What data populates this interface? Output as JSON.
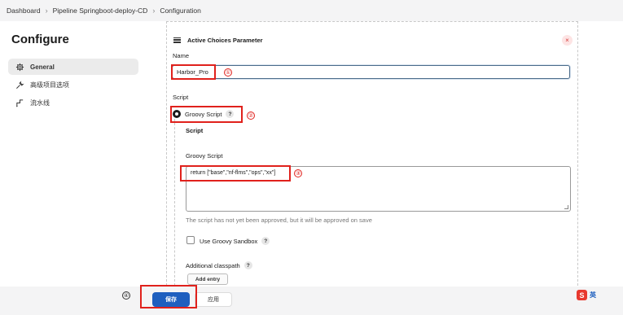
{
  "breadcrumb": [
    "Dashboard",
    "Pipeline Springboot-deploy-CD",
    "Configuration"
  ],
  "page_title": "Configure",
  "sidebar": {
    "items": [
      {
        "label": "General",
        "icon": "gear-icon",
        "active": true
      },
      {
        "label": "高级项目选项",
        "icon": "wrench-icon",
        "active": false
      },
      {
        "label": "流水线",
        "icon": "pipeline-icon",
        "active": false
      }
    ]
  },
  "parameter": {
    "type_label": "Active Choices Parameter",
    "close_symbol": "×",
    "name_label": "Name",
    "name_value": "Harbor_Pro",
    "script_label": "Script",
    "groovy_radio_label": "Groovy Script",
    "script_subheading": "Script",
    "groovy_script_label": "Groovy Script",
    "groovy_script_value": "return [\"base\",\"nf-flms\",\"ops\",\"xx\"]",
    "approval_note": "The script has not yet been approved, but it will be approved on save",
    "sandbox_label": "Use Groovy Sandbox",
    "classpath_label": "Additional classpath",
    "add_entry_label": "Add entry",
    "help_symbol": "?"
  },
  "actions": {
    "save_label": "保存",
    "apply_label": "应用"
  },
  "annotations": [
    "①",
    "②",
    "③",
    "④"
  ],
  "ime": {
    "logo": "S",
    "lang": "英"
  },
  "colors": {
    "accent": "#1e5fbf",
    "annotation_red": "#e0211c",
    "breadcrumb_bg": "#f4f4f5"
  }
}
